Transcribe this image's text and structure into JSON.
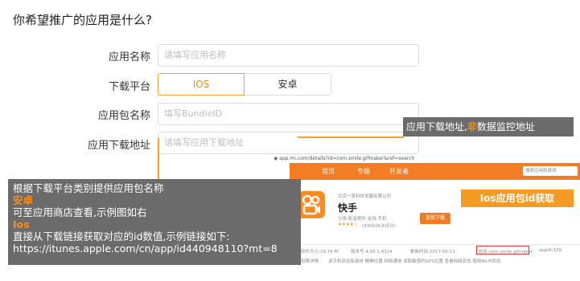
{
  "page_title": "你希望推广的应用是什么?",
  "form": {
    "app_name": {
      "label": "应用名称",
      "placeholder": "请填写应用名称"
    },
    "platform": {
      "label": "下载平台",
      "options": [
        "IOS",
        "安卓"
      ],
      "selected": "IOS"
    },
    "bundle_id": {
      "label": "应用包名称",
      "placeholder": "填写BundleID"
    },
    "download_url": {
      "label": "应用下载地址",
      "placeholder": "请填写应用下载地址"
    }
  },
  "callout_right": {
    "prefix": "应用下载地址,",
    "highlight": "非",
    "suffix": "数据监控地址"
  },
  "callout_left": {
    "intro": "根据下载平台类别提供应用包名称",
    "android_heading": "安卓",
    "android_text": "可至应用商店查看,示例图如右",
    "ios_heading": "Ios",
    "ios_text": "直接从下载链接获取对应的id数值,示例链接如下:",
    "ios_link": "https://itunes.apple.com/cn/app/id440948110?mt=8"
  },
  "example_screenshot": {
    "url": "app.mi.com/details?id=com.smile.gifmaker&ref=search",
    "nav": [
      "首页",
      "专题",
      "开发者"
    ],
    "search_placeholder": "搜索应用和游戏",
    "app_name": "快手",
    "developer": "北京一笑科技发展有限公司",
    "category": "分类:影音视听  支持:手机",
    "rating": "(430026次评分)",
    "download_button": "直接下载",
    "ios_banner": "Ios应用包id获取",
    "meta_size": "软件大小:29.74 M",
    "meta_version": "版本号:4.56.1.4324",
    "meta_updated": "更新时间:2017-05-11",
    "meta_package": "包名:com.smile.gifmaker",
    "meta_appid": "appId:329",
    "perm_label": "权限详情",
    "perm_items": "读手机状态和身份  精确位置  网络通信  读取敏感的GPS位置  查看网络状态  使用Wi-Fi状态"
  },
  "colors": {
    "accent_orange": "#f5901f",
    "nav_orange": "#f57c22",
    "callout_gray": "#6b6b6b"
  }
}
